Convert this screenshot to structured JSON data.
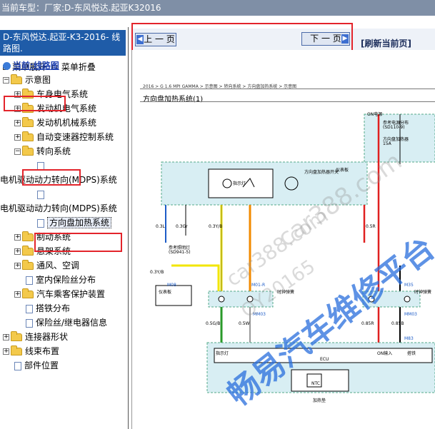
{
  "topbar": {
    "label": "当前车型：",
    "model": "厂家:D-东风悦达.起亚K32016"
  },
  "left_panel": {
    "header": "D-东风悦达.起亚-K3-2016- 线路图.",
    "expand_label": "菜单展开",
    "collapse_label": "菜单折叠",
    "current_link": "当前:线路图",
    "tree": [
      {
        "label": "示意图"
      },
      {
        "label": "车身电气系统"
      },
      {
        "label": "发动机电气系统"
      },
      {
        "label": "发动机机械系统"
      },
      {
        "label": "自动变速器控制系统"
      },
      {
        "label": "转向系统"
      },
      {
        "label": "电机驱动动力转向(MDPS)系统"
      },
      {
        "label": "电机驱动动力转向(MDPS)系统"
      },
      {
        "label": "方向盘加热系统"
      },
      {
        "label": "制动系统"
      },
      {
        "label": "悬架系统"
      },
      {
        "label": "通风、空调"
      },
      {
        "label": "室内保险丝分布"
      },
      {
        "label": "汽车乘客保护装置"
      },
      {
        "label": "搭铁分布"
      },
      {
        "label": "保险丝/继电器信息"
      },
      {
        "label": "连接器形状"
      },
      {
        "label": "线束布置"
      },
      {
        "label": "部件位置"
      }
    ]
  },
  "toolbar": {
    "prev_label": "上 一 页",
    "next_label": "下 一 页",
    "refresh_label": "[刷新当前页]"
  },
  "diagram": {
    "header": "2016 > G 1.6 MPI GAMMA > 示意图 > 转向系统 > 方向盘加热系统 > 示意图",
    "title": "方向盘加热系统(1)",
    "labels": {
      "on_power": "ON电源",
      "fuse_ref": "参考电源分布",
      "fuse_code": "(SD110-9)",
      "fuse_name": "方向盘加热器",
      "fuse_amp": "15A",
      "indicator": "指示灯",
      "lamp_ref": "参考照明灯",
      "lamp_code": "(SD941-5)",
      "panel": "仪表板",
      "heater_switch": "方向盘加热器开关",
      "m08": "M08",
      "m01r": "M01-R",
      "m35": "M35",
      "mm03": "MM03",
      "m83": "M83",
      "ecu": "ECU",
      "on_input": "ON输入",
      "ground": "搭铁",
      "clock_spring": "时钟弹簧",
      "ntc": "NTC",
      "heating_pad": "加热垫",
      "w_03l": "0.3L",
      "w_03gr": "0.3Gr",
      "w_03yb": "0.3Y/B",
      "w_05r": "0.5R",
      "w_03b": "0.3B",
      "w_05gb": "0.5G/B",
      "w_05w": "0.5W",
      "w_085r": "0.85R",
      "w_085b": "0.85B"
    }
  },
  "watermarks": {
    "site1": "car388.com",
    "site2": "car388.com",
    "phone": "QY20165",
    "brand": "畅易汽车维修平台"
  },
  "colors": {
    "topbar_bg": "#7f8fa6",
    "header_bg": "#1f5ca8",
    "highlight_red": "#e3242b",
    "diagram_cyan": "#d8eef3",
    "wire_yellow": "#f2e600",
    "wire_orange": "#f28a00",
    "wire_blue": "#1d5cc8",
    "wire_red": "#e02020",
    "wire_green": "#2a9a2a"
  }
}
